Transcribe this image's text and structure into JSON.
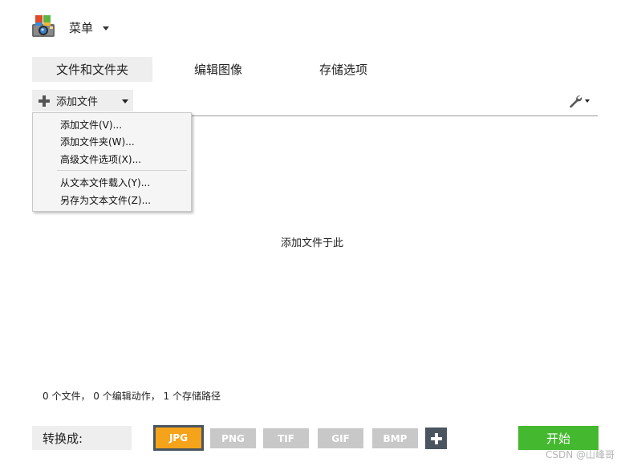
{
  "header": {
    "menu_label": "菜单",
    "logo_icon": "camera-app-icon"
  },
  "tabs": [
    {
      "label": "文件和文件夹",
      "active": true
    },
    {
      "label": "编辑图像",
      "active": false
    },
    {
      "label": "存储选项",
      "active": false
    }
  ],
  "toolbar": {
    "add_file_label": "添加文件",
    "add_icon": "plus-icon",
    "settings_icon": "wrench-icon"
  },
  "dropdown": {
    "items": [
      "添加文件(V)...",
      "添加文件夹(W)...",
      "高级文件选项(X)...",
      "从文本文件载入(Y)...",
      "另存为文本文件(Z)..."
    ]
  },
  "drop_area": {
    "hint": "添加文件于此"
  },
  "status": {
    "text": "0 个文件， 0 个编辑动作， 1 个存储路径"
  },
  "bottom": {
    "convert_label": "转换成:",
    "formats": [
      "JPG",
      "PNG",
      "TIF",
      "GIF",
      "BMP"
    ],
    "selected_format": "JPG",
    "start_label": "开始",
    "colors": {
      "selected": "#f5a31a",
      "unselected": "#c8c8c8",
      "start": "#44b82f",
      "add": "#4a5560"
    }
  },
  "watermark": "CSDN @山峰哥"
}
